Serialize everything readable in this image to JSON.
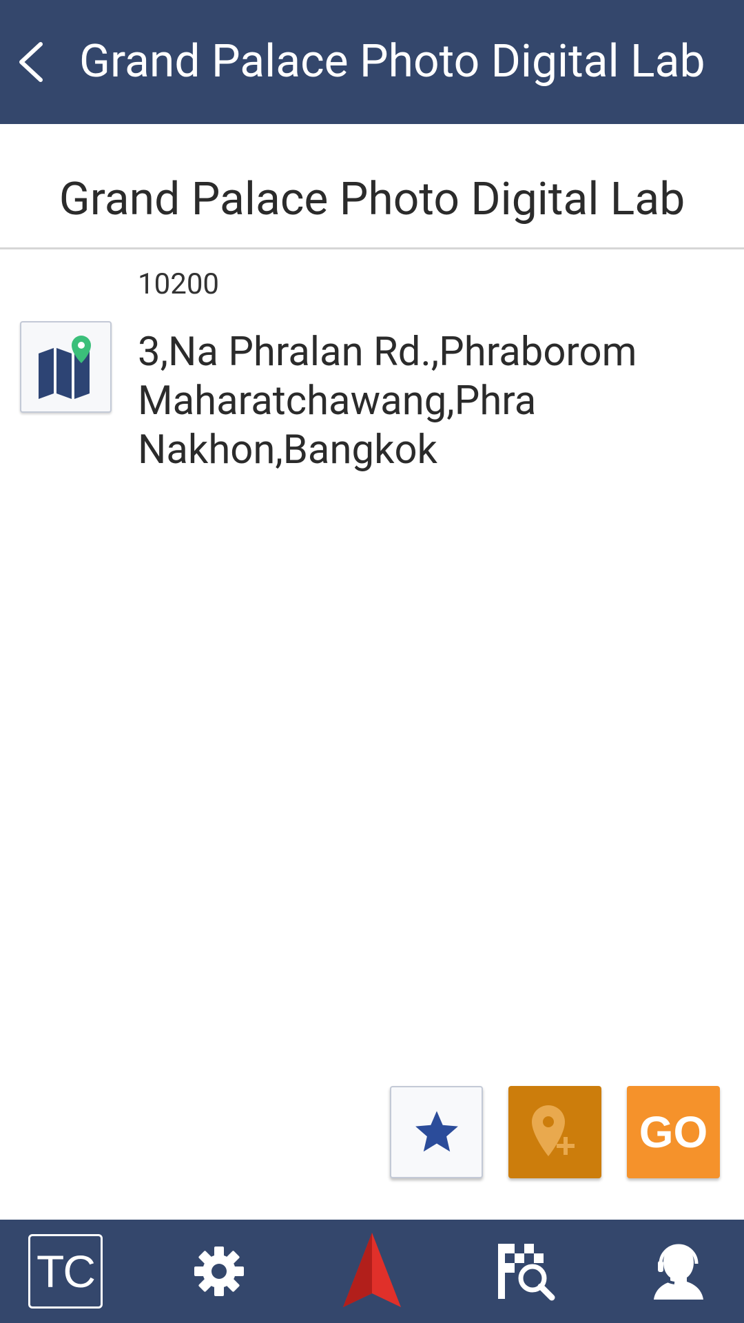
{
  "header": {
    "title": "Grand Palace Photo Digital Lab",
    "back_icon": "chevron-left-icon"
  },
  "place": {
    "name": "Grand Palace Photo Digital Lab",
    "postcode": "10200",
    "address": "3,Na Phralan Rd.,Phraborom Maharatchawang,Phra Nakhon,Bangkok",
    "map_icon": "map-pin-icon"
  },
  "actions": {
    "favorite_icon": "star-icon",
    "add_poi_icon": "add-location-icon",
    "go_label": "GO"
  },
  "bottom_nav": {
    "tc_label": "TC",
    "settings_icon": "gear-icon",
    "navigate_icon": "navigation-arrow-icon",
    "search_icon": "destination-search-icon",
    "support_icon": "support-agent-icon"
  },
  "colors": {
    "bar": "#34476c",
    "go": "#f5922b",
    "add_poi": "#cc7d0c",
    "accent_red": "#e0302a",
    "star": "#2b4c9a",
    "pin": "#3bbf7a"
  }
}
